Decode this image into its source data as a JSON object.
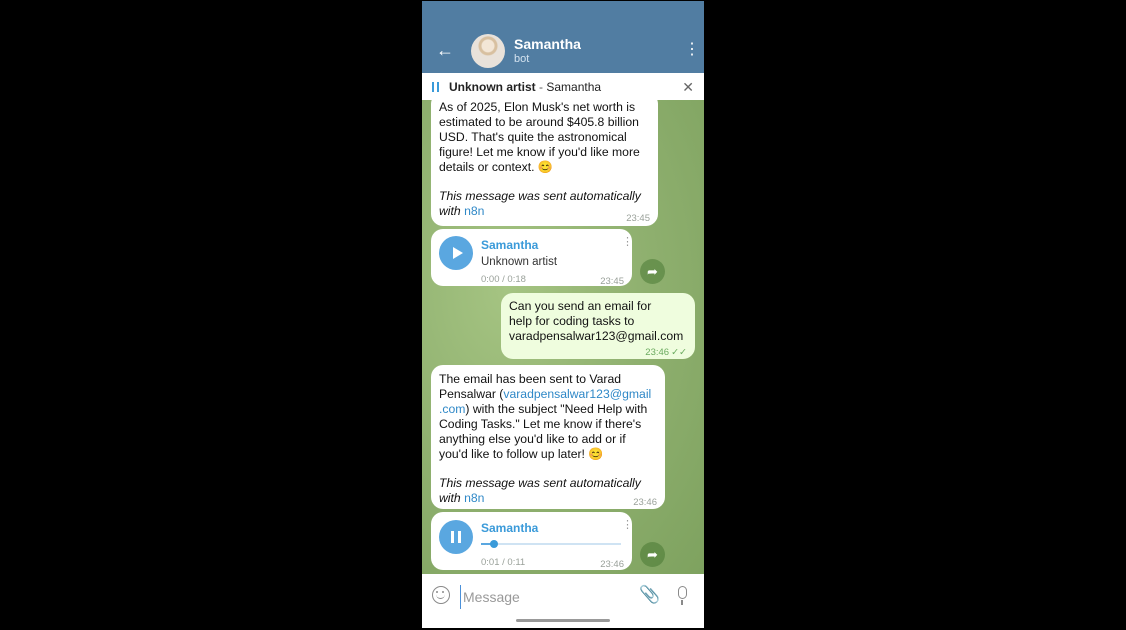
{
  "header": {
    "name": "Samantha",
    "subtitle": "bot"
  },
  "player": {
    "artist": "Unknown artist",
    "separator": " - ",
    "title": "Samantha"
  },
  "messages": [
    {
      "lines": [
        "As of 2025, Elon Musk's net worth is",
        "estimated to be around $405.8 billion",
        "USD. That's quite the astronomical",
        "figure! Let me know if you'd like more",
        "details or context. 😊"
      ],
      "auto_text": "This message was sent automatically",
      "auto_prefix": "with ",
      "auto_link": "n8n",
      "time": "23:45"
    },
    {
      "voice_title": "Samantha",
      "voice_artist": "Unknown artist",
      "duration": "0:00 / 0:18",
      "time": "23:45"
    },
    {
      "lines": [
        "Can you send an email for",
        "help for coding tasks to",
        "varadpensalwar123@gmail.com"
      ],
      "time": "23:46"
    },
    {
      "line1": "The email has been sent to Varad",
      "line2_pre": "Pensalwar (",
      "line2_link": "varadpensalwar123@gmail",
      "line3_link": ".com",
      "line3_post": ") with the subject \"Need Help with",
      "lines_rest": [
        "Coding Tasks.\" Let me know if there's",
        "anything else you'd like to add or if",
        "you'd like to follow up later! 😊"
      ],
      "auto_text": "This message was sent automatically",
      "auto_prefix": "with ",
      "auto_link": "n8n",
      "time": "23:46"
    },
    {
      "voice_title": "Samantha",
      "duration": "0:01 / 0:11",
      "time": "23:46",
      "progress": 0.09
    }
  ],
  "input": {
    "placeholder": "Message"
  }
}
